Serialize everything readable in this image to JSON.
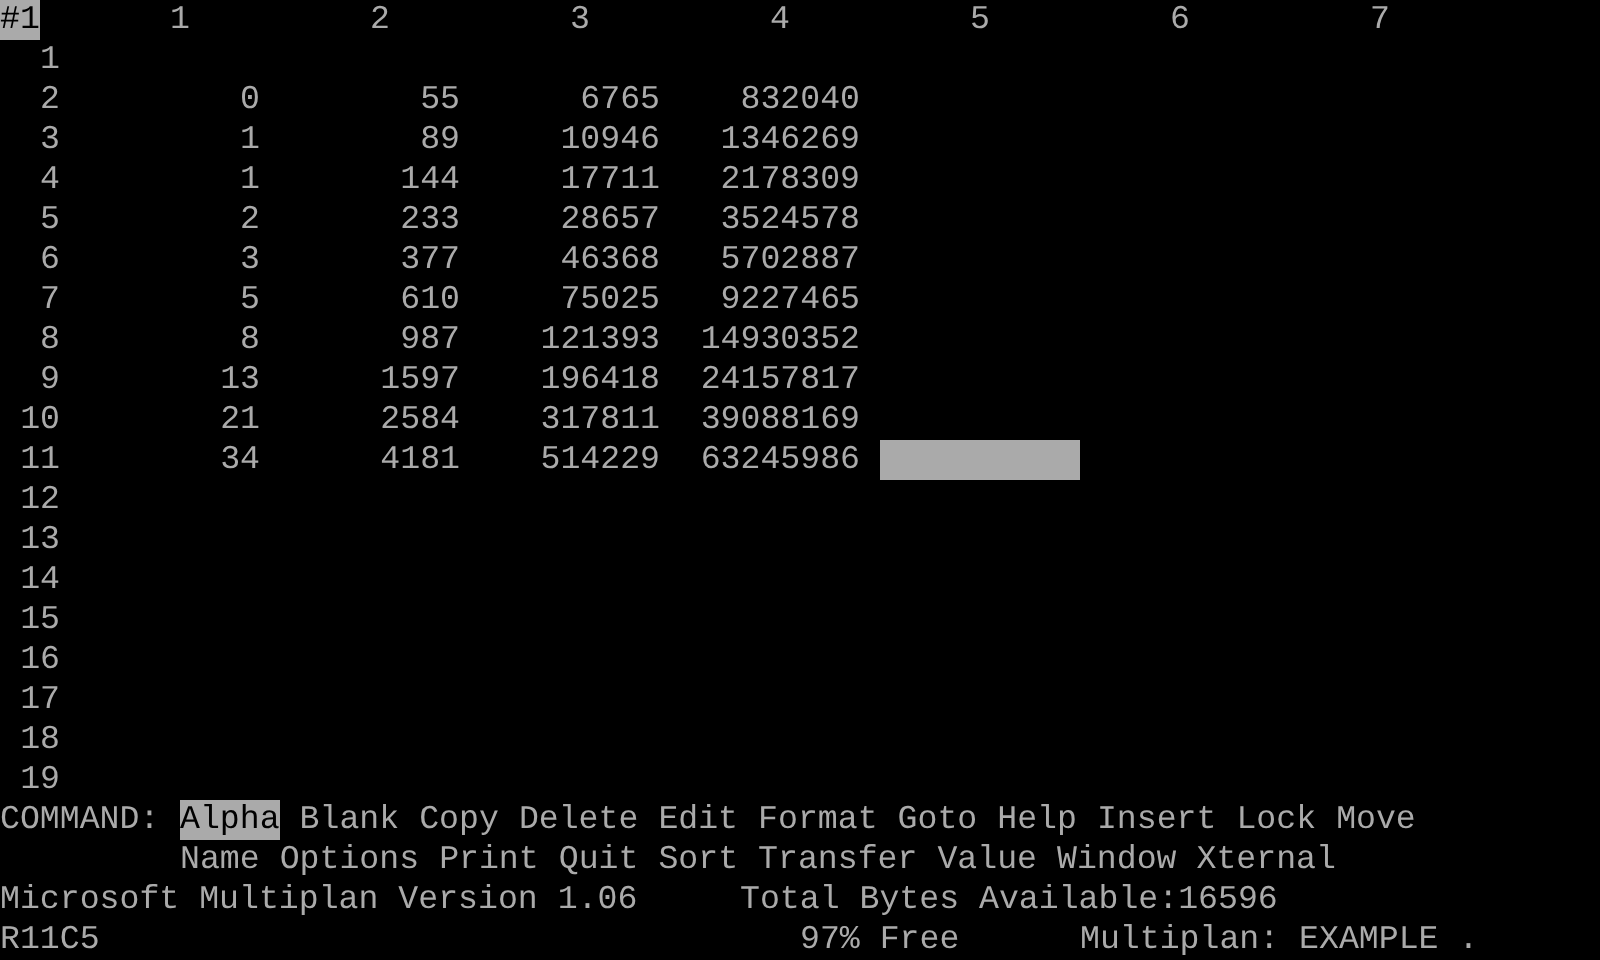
{
  "corner": "#1",
  "columns": [
    {
      "label": "1"
    },
    {
      "label": "2"
    },
    {
      "label": "3"
    },
    {
      "label": "4"
    },
    {
      "label": "5"
    },
    {
      "label": "6"
    },
    {
      "label": "7"
    }
  ],
  "rows": [
    {
      "label": "1",
      "cursor": false,
      "cells": []
    },
    {
      "label": "2",
      "cursor": false,
      "cells": [
        "0",
        "55",
        "6765",
        "832040"
      ]
    },
    {
      "label": "3",
      "cursor": false,
      "cells": [
        "1",
        "89",
        "10946",
        "1346269"
      ]
    },
    {
      "label": "4",
      "cursor": false,
      "cells": [
        "1",
        "144",
        "17711",
        "2178309"
      ]
    },
    {
      "label": "5",
      "cursor": false,
      "cells": [
        "2",
        "233",
        "28657",
        "3524578"
      ]
    },
    {
      "label": "6",
      "cursor": false,
      "cells": [
        "3",
        "377",
        "46368",
        "5702887"
      ]
    },
    {
      "label": "7",
      "cursor": false,
      "cells": [
        "5",
        "610",
        "75025",
        "9227465"
      ]
    },
    {
      "label": "8",
      "cursor": false,
      "cells": [
        "8",
        "987",
        "121393",
        "14930352"
      ]
    },
    {
      "label": "9",
      "cursor": false,
      "cells": [
        "13",
        "1597",
        "196418",
        "24157817"
      ]
    },
    {
      "label": "10",
      "cursor": false,
      "cells": [
        "21",
        "2584",
        "317811",
        "39088169"
      ]
    },
    {
      "label": "11",
      "cursor": true,
      "cells": [
        "34",
        "4181",
        "514229",
        "63245986"
      ]
    },
    {
      "label": "12",
      "cursor": false,
      "cells": []
    },
    {
      "label": "13",
      "cursor": false,
      "cells": []
    },
    {
      "label": "14",
      "cursor": false,
      "cells": []
    },
    {
      "label": "15",
      "cursor": false,
      "cells": []
    },
    {
      "label": "16",
      "cursor": false,
      "cells": []
    },
    {
      "label": "17",
      "cursor": false,
      "cells": []
    },
    {
      "label": "18",
      "cursor": false,
      "cells": []
    },
    {
      "label": "19",
      "cursor": false,
      "cells": []
    }
  ],
  "command_menu": {
    "label": "COMMAND:",
    "items": [
      {
        "label": "Alpha",
        "selected": true
      },
      {
        "label": "Blank",
        "selected": false
      },
      {
        "label": "Copy",
        "selected": false
      },
      {
        "label": "Delete",
        "selected": false
      },
      {
        "label": "Edit",
        "selected": false
      },
      {
        "label": "Format",
        "selected": false
      },
      {
        "label": "Goto",
        "selected": false
      },
      {
        "label": "Help",
        "selected": false
      },
      {
        "label": "Insert",
        "selected": false
      },
      {
        "label": "Lock",
        "selected": false
      },
      {
        "label": "Move",
        "selected": false
      },
      {
        "label": "Name",
        "selected": false
      },
      {
        "label": "Options",
        "selected": false
      },
      {
        "label": "Print",
        "selected": false
      },
      {
        "label": "Quit",
        "selected": false
      },
      {
        "label": "Sort",
        "selected": false
      },
      {
        "label": "Transfer",
        "selected": false
      },
      {
        "label": "Value",
        "selected": false
      },
      {
        "label": "Window",
        "selected": false
      },
      {
        "label": "Xternal",
        "selected": false
      }
    ]
  },
  "message_line": {
    "version": "Microsoft Multiplan Version 1.06",
    "bytes": "Total Bytes Available:16596"
  },
  "status_line": {
    "cell": "R11C5",
    "free": "97% Free",
    "file": "Multiplan: EXAMPLE ."
  }
}
